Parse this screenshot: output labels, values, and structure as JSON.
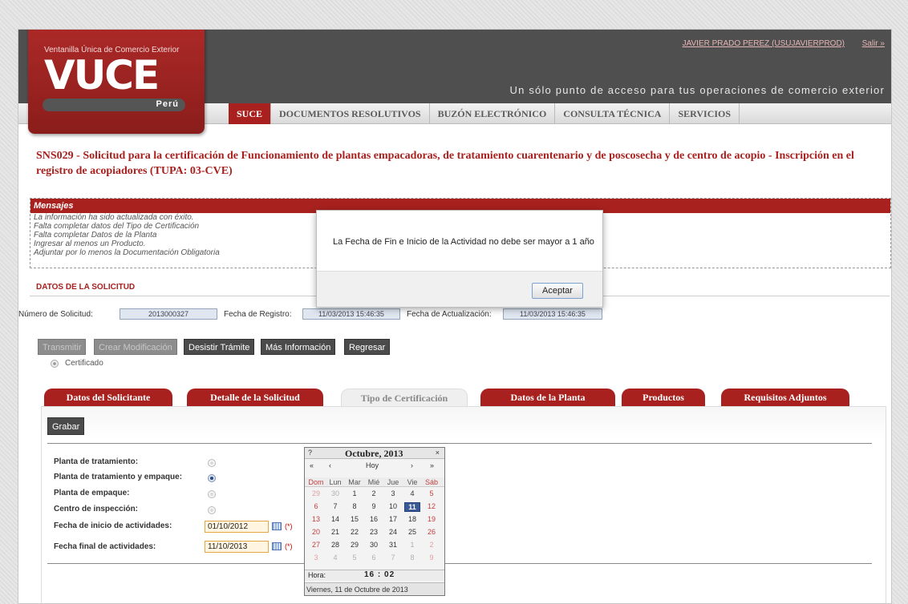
{
  "header": {
    "logo_sub": "Ventanilla Única de Comercio Exterior",
    "logo_main": "VUCE",
    "logo_country": "Perú",
    "user": "JAVIER PRADO PEREZ (USUJAVIERPROD)",
    "logout": "Salir »",
    "tagline": "Un sólo punto de acceso para tus operaciones de comercio exterior"
  },
  "nav": [
    {
      "label": "SUCE"
    },
    {
      "label": "DOCUMENTOS RESOLUTIVOS"
    },
    {
      "label": "BUZÓN ELECTRÓNICO"
    },
    {
      "label": "CONSULTA TÉCNICA"
    },
    {
      "label": "SERVICIOS"
    }
  ],
  "page_title": "SNS029 - Solicitud para la certificación de Funcionamiento de plantas empacadoras, de tratamiento cuarentenario y de poscosecha y de centro de acopio - Inscripción en el registro de acopiadores (TUPA: 03-CVE)",
  "messages": {
    "header": "Mensajes",
    "lines": [
      "La información ha sido actualizada con éxito.",
      "Falta completar datos del Tipo de Certificación",
      "Falta completar Datos de la Planta",
      "Ingresar al menos un Producto.",
      "Adjuntar por lo menos la Documentación Obligatoria"
    ]
  },
  "datos": {
    "title": "DATOS DE LA SOLICITUD",
    "numero_label": "Número de Solicitud:",
    "numero_value": "2013000327",
    "registro_label": "Fecha de Registro:",
    "registro_value": "11/03/2013 15:46:35",
    "actualizacion_label": "Fecha de Actualización:",
    "actualizacion_value": "11/03/2013 15:46:35"
  },
  "actions": {
    "transmitir": "Transmitir",
    "crear": "Crear Modificación",
    "desistir": "Desistir Trámite",
    "info": "Más Información",
    "regresar": "Regresar"
  },
  "certificado_label": "Certificado",
  "tabs": [
    {
      "label": "Datos del Solicitante"
    },
    {
      "label": "Detalle de la Solicitud"
    },
    {
      "label": "Tipo de Certificación"
    },
    {
      "label": "Datos de la Planta"
    },
    {
      "label": "Productos"
    },
    {
      "label": "Requisitos Adjuntos"
    }
  ],
  "form": {
    "grabar": "Grabar",
    "planta_tratamiento": "Planta de tratamiento:",
    "planta_tratamiento_empaque": "Planta de tratamiento y empaque:",
    "planta_empaque": "Planta de empaque:",
    "centro_inspeccion": "Centro de inspección:",
    "fecha_inicio_label": "Fecha de inicio de actividades:",
    "fecha_inicio_value": "01/10/2012",
    "fecha_final_label": "Fecha final de actividades:",
    "fecha_final_value": "11/10/2013",
    "required": "(*)"
  },
  "calendar": {
    "help": "?",
    "month": "Octubre, 2013",
    "close": "×",
    "nav": [
      "«",
      "‹",
      "Hoy",
      "›",
      "»"
    ],
    "daynames": [
      "Dom",
      "Lun",
      "Mar",
      "Mié",
      "Jue",
      "Vie",
      "Sáb"
    ],
    "weeks": [
      [
        "29",
        "30",
        "1",
        "2",
        "3",
        "4",
        "5"
      ],
      [
        "6",
        "7",
        "8",
        "9",
        "10",
        "11",
        "12"
      ],
      [
        "13",
        "14",
        "15",
        "16",
        "17",
        "18",
        "19"
      ],
      [
        "20",
        "21",
        "22",
        "23",
        "24",
        "25",
        "26"
      ],
      [
        "27",
        "28",
        "29",
        "30",
        "31",
        "1",
        "2"
      ],
      [
        "3",
        "4",
        "5",
        "6",
        "7",
        "8",
        "9"
      ]
    ],
    "selected_day": "11",
    "time_label": "Hora:",
    "time": "16 : 02",
    "status": "Viernes, 11 de Octubre de 2013"
  },
  "dialog": {
    "message": "La Fecha de Fin e Inicio de la Actividad no debe ser mayor a 1 año",
    "ok": "Aceptar"
  },
  "colors": {
    "brand_red": "#a8211e",
    "header_gray": "#4f4f4f",
    "calendar_selected": "#3b5a95"
  }
}
